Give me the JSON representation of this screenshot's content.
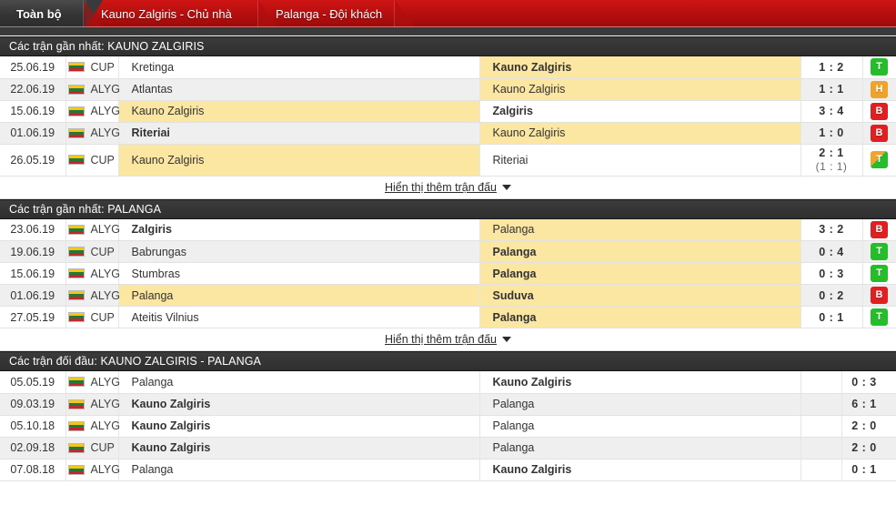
{
  "tabs": [
    {
      "label": "Toàn bộ",
      "active": true
    },
    {
      "label": "Kauno Zalgiris - Chủ nhà",
      "active": false
    },
    {
      "label": "Palanga - Đội khách",
      "active": false
    }
  ],
  "show_more_label": "Hiển thị thêm trận đấu",
  "colors": {
    "tab_red": "#c8100f",
    "tab_active_gray": "#3a3a3a",
    "section_header": "#333333",
    "highlight_yellow": "#fbe6a2",
    "badge_win": "#26bd2b",
    "badge_loss": "#e02020",
    "badge_draw": "#eda32c"
  },
  "sections": [
    {
      "title": "Các trận gần nhất: KAUNO ZALGIRIS",
      "has_badge_column": true,
      "rows": [
        {
          "date": "25.06.19",
          "competition": "CUP",
          "flag": "lithuania-flag",
          "home": "Kretinga",
          "home_bold": false,
          "home_hl": false,
          "away": "Kauno Zalgiris",
          "away_bold": true,
          "away_hl": true,
          "score": "1 : 2",
          "score_sub": "",
          "badge": "T",
          "badge_style": "T",
          "tall": false
        },
        {
          "date": "22.06.19",
          "competition": "ALYG",
          "flag": "lithuania-flag",
          "home": "Atlantas",
          "home_bold": false,
          "home_hl": false,
          "away": "Kauno Zalgiris",
          "away_bold": false,
          "away_hl": true,
          "score": "1 : 1",
          "score_sub": "",
          "badge": "H",
          "badge_style": "H",
          "tall": false
        },
        {
          "date": "15.06.19",
          "competition": "ALYG",
          "flag": "lithuania-flag",
          "home": "Kauno Zalgiris",
          "home_bold": false,
          "home_hl": true,
          "away": "Zalgiris",
          "away_bold": true,
          "away_hl": false,
          "score": "3 : 4",
          "score_sub": "",
          "badge": "B",
          "badge_style": "B",
          "tall": false
        },
        {
          "date": "01.06.19",
          "competition": "ALYG",
          "flag": "lithuania-flag",
          "home": "Riteriai",
          "home_bold": true,
          "home_hl": false,
          "away": "Kauno Zalgiris",
          "away_bold": false,
          "away_hl": true,
          "score": "1 : 0",
          "score_sub": "",
          "badge": "B",
          "badge_style": "B",
          "tall": false
        },
        {
          "date": "26.05.19",
          "competition": "CUP",
          "flag": "lithuania-flag",
          "home": "Kauno Zalgiris",
          "home_bold": false,
          "home_hl": true,
          "away": "Riteriai",
          "away_bold": false,
          "away_hl": false,
          "score": "2 : 1",
          "score_sub": "(1 : 1)",
          "badge": "T",
          "badge_style": "split",
          "tall": true
        }
      ]
    },
    {
      "title": "Các trận gần nhất: PALANGA",
      "has_badge_column": true,
      "rows": [
        {
          "date": "23.06.19",
          "competition": "ALYG",
          "flag": "lithuania-flag",
          "home": "Zalgiris",
          "home_bold": true,
          "home_hl": false,
          "away": "Palanga",
          "away_bold": false,
          "away_hl": true,
          "score": "3 : 2",
          "score_sub": "",
          "badge": "B",
          "badge_style": "B",
          "tall": false
        },
        {
          "date": "19.06.19",
          "competition": "CUP",
          "flag": "lithuania-flag",
          "home": "Babrungas",
          "home_bold": false,
          "home_hl": false,
          "away": "Palanga",
          "away_bold": true,
          "away_hl": true,
          "score": "0 : 4",
          "score_sub": "",
          "badge": "T",
          "badge_style": "T",
          "tall": false
        },
        {
          "date": "15.06.19",
          "competition": "ALYG",
          "flag": "lithuania-flag",
          "home": "Stumbras",
          "home_bold": false,
          "home_hl": false,
          "away": "Palanga",
          "away_bold": true,
          "away_hl": true,
          "score": "0 : 3",
          "score_sub": "",
          "badge": "T",
          "badge_style": "T",
          "tall": false
        },
        {
          "date": "01.06.19",
          "competition": "ALYG",
          "flag": "lithuania-flag",
          "home": "Palanga",
          "home_bold": false,
          "home_hl": true,
          "away": "Suduva",
          "away_bold": true,
          "away_hl": true,
          "score": "0 : 2",
          "score_sub": "",
          "badge": "B",
          "badge_style": "B",
          "tall": false
        },
        {
          "date": "27.05.19",
          "competition": "CUP",
          "flag": "lithuania-flag",
          "home": "Ateitis Vilnius",
          "home_bold": false,
          "home_hl": false,
          "away": "Palanga",
          "away_bold": true,
          "away_hl": true,
          "score": "0 : 1",
          "score_sub": "",
          "badge": "T",
          "badge_style": "T",
          "tall": false
        }
      ]
    },
    {
      "title": "Các trận đối đầu: KAUNO ZALGIRIS - PALANGA",
      "has_badge_column": false,
      "rows": [
        {
          "date": "05.05.19",
          "competition": "ALYG",
          "flag": "lithuania-flag",
          "home": "Palanga",
          "home_bold": false,
          "home_hl": false,
          "away": "Kauno Zalgiris",
          "away_bold": true,
          "away_hl": false,
          "score": "0 : 3",
          "score_sub": "",
          "badge": "",
          "badge_style": "",
          "tall": false
        },
        {
          "date": "09.03.19",
          "competition": "ALYG",
          "flag": "lithuania-flag",
          "home": "Kauno Zalgiris",
          "home_bold": true,
          "home_hl": false,
          "away": "Palanga",
          "away_bold": false,
          "away_hl": false,
          "score": "6 : 1",
          "score_sub": "",
          "badge": "",
          "badge_style": "",
          "tall": false
        },
        {
          "date": "05.10.18",
          "competition": "ALYG",
          "flag": "lithuania-flag",
          "home": "Kauno Zalgiris",
          "home_bold": true,
          "home_hl": false,
          "away": "Palanga",
          "away_bold": false,
          "away_hl": false,
          "score": "2 : 0",
          "score_sub": "",
          "badge": "",
          "badge_style": "",
          "tall": false
        },
        {
          "date": "02.09.18",
          "competition": "CUP",
          "flag": "lithuania-flag",
          "home": "Kauno Zalgiris",
          "home_bold": true,
          "home_hl": false,
          "away": "Palanga",
          "away_bold": false,
          "away_hl": false,
          "score": "2 : 0",
          "score_sub": "",
          "badge": "",
          "badge_style": "",
          "tall": false
        },
        {
          "date": "07.08.18",
          "competition": "ALYG",
          "flag": "lithuania-flag",
          "home": "Palanga",
          "home_bold": false,
          "home_hl": false,
          "away": "Kauno Zalgiris",
          "away_bold": true,
          "away_hl": false,
          "score": "0 : 1",
          "score_sub": "",
          "badge": "",
          "badge_style": "",
          "tall": false
        }
      ]
    }
  ]
}
